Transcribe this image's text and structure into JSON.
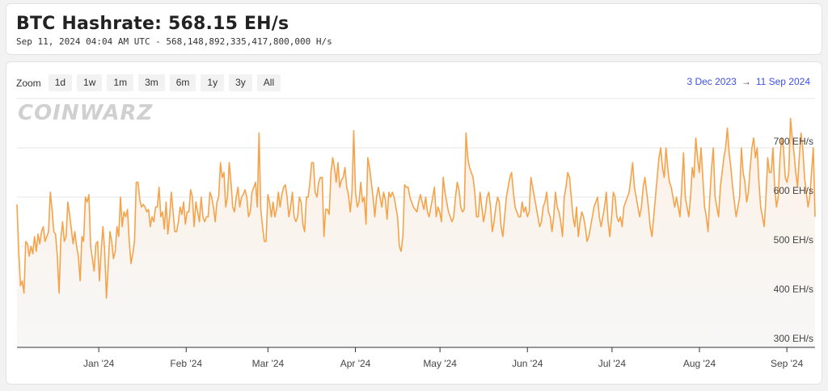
{
  "header": {
    "title": "BTC Hashrate: 568.15 EH/s",
    "subtitle": "Sep 11, 2024 04:04 AM UTC - 568,148,892,335,417,800,000 H/s"
  },
  "zoom": {
    "label": "Zoom",
    "buttons": [
      "1d",
      "1w",
      "1m",
      "3m",
      "6m",
      "1y",
      "3y",
      "All"
    ]
  },
  "range": {
    "from": "3 Dec 2023",
    "arrow": "→",
    "to": "11 Sep 2024"
  },
  "watermark": "COINWARZ",
  "colors": {
    "line": "#f5a34a",
    "area_top": "#fdf1e6",
    "link": "#3b50e6"
  },
  "chart_data": {
    "type": "area",
    "title": "BTC Hashrate: 568.15 EH/s",
    "xlabel": "",
    "ylabel": "",
    "ylim": [
      295,
      800
    ],
    "yticks": [
      300,
      400,
      500,
      600,
      700
    ],
    "ytick_labels": [
      "300 EH/s",
      "400 EH/s",
      "500 EH/s",
      "600 EH/s",
      "700 EH/s"
    ],
    "x_start": "2023-12-03",
    "x_end": "2024-09-11",
    "xticks": [
      "2024-01-01",
      "2024-02-01",
      "2024-03-01",
      "2024-04-01",
      "2024-05-01",
      "2024-06-01",
      "2024-07-01",
      "2024-08-01",
      "2024-09-01"
    ],
    "xtick_labels": [
      "Jan '24",
      "Feb '24",
      "Mar '24",
      "Apr '24",
      "May '24",
      "Jun '24",
      "Jul '24",
      "Aug '24",
      "Sep '24"
    ],
    "grid": true,
    "series": [
      {
        "values": [
          585,
          490,
          420,
          430,
          405,
          510,
          505,
          480,
          500,
          485,
          520,
          490,
          525,
          505,
          530,
          540,
          510,
          520,
          530,
          610,
          575,
          530,
          525,
          480,
          405,
          515,
          550,
          510,
          520,
          590,
          565,
          535,
          505,
          530,
          500,
          480,
          430,
          520,
          510,
          600,
          590,
          605,
          500,
          475,
          450,
          505,
          510,
          430,
          490,
          540,
          490,
          395,
          460,
          530,
          510,
          475,
          490,
          540,
          520,
          600,
          540,
          570,
          560,
          575,
          510,
          465,
          485,
          510,
          630,
          630,
          595,
          580,
          585,
          580,
          570,
          575,
          540,
          560,
          550,
          580,
          580,
          620,
          560,
          570,
          535,
          590,
          525,
          560,
          610,
          570,
          530,
          530,
          550,
          580,
          565,
          590,
          545,
          570,
          570,
          615,
          600,
          540,
          590,
          570,
          550,
          600,
          560,
          550,
          560,
          560,
          610,
          600,
          580,
          550,
          590,
          600,
          670,
          640,
          650,
          580,
          600,
          670,
          630,
          580,
          570,
          600,
          620,
          580,
          600,
          605,
          615,
          600,
          560,
          570,
          610,
          620,
          630,
          580,
          730,
          575,
          540,
          510,
          510,
          605,
          590,
          560,
          590,
          560,
          575,
          610,
          580,
          605,
          620,
          625,
          600,
          560,
          580,
          610,
          560,
          550,
          560,
          600,
          590,
          545,
          530,
          600,
          600,
          630,
          670,
          670,
          610,
          600,
          630,
          640,
          640,
          520,
          575,
          575,
          565,
          650,
          680,
          660,
          630,
          670,
          620,
          635,
          640,
          660,
          620,
          605,
          570,
          610,
          735,
          610,
          580,
          590,
          630,
          590,
          600,
          545,
          680,
          660,
          630,
          600,
          560,
          600,
          620,
          600,
          580,
          610,
          595,
          555,
          610,
          600,
          610,
          600,
          580,
          560,
          500,
          490,
          520,
          625,
          620,
          620,
          600,
          590,
          580,
          575,
          570,
          590,
          605,
          590,
          575,
          600,
          570,
          560,
          580,
          600,
          620,
          560,
          580,
          570,
          550,
          640,
          610,
          590,
          570,
          560,
          550,
          560,
          600,
          630,
          615,
          580,
          570,
          575,
          730,
          680,
          660,
          650,
          640,
          610,
          560,
          560,
          610,
          580,
          550,
          570,
          600,
          610,
          580,
          530,
          550,
          580,
          600,
          590,
          540,
          520,
          560,
          600,
          620,
          640,
          650,
          610,
          580,
          570,
          560,
          560,
          590,
          570,
          580,
          560,
          570,
          640,
          620,
          600,
          580,
          560,
          540,
          550,
          580,
          590,
          610,
          570,
          560,
          530,
          560,
          610,
          580,
          570,
          550,
          520,
          600,
          620,
          650,
          640,
          600,
          560,
          540,
          580,
          520,
          550,
          570,
          560,
          540,
          510,
          520,
          540,
          560,
          580,
          590,
          600,
          560,
          540,
          560,
          580,
          610,
          550,
          520,
          560,
          610,
          600,
          560,
          550,
          560,
          540,
          580,
          590,
          600,
          610,
          640,
          670,
          620,
          600,
          580,
          560,
          580,
          620,
          640,
          610,
          580,
          540,
          520,
          560,
          600,
          640,
          680,
          700,
          660,
          640,
          700,
          660,
          630,
          620,
          600,
          580,
          600,
          580,
          560,
          620,
          690,
          600,
          580,
          560,
          600,
          660,
          640,
          720,
          680,
          650,
          700,
          640,
          580,
          560,
          530,
          600,
          660,
          700,
          600,
          580,
          560,
          620,
          650,
          680,
          700,
          740,
          690,
          660,
          620,
          590,
          560,
          580,
          600,
          700,
          650,
          630,
          590,
          610,
          660,
          700,
          720,
          680,
          700,
          630,
          580,
          560,
          540,
          600,
          680,
          650,
          650,
          700,
          620,
          580,
          600,
          680,
          720,
          700,
          640,
          630,
          650,
          760,
          720,
          690,
          650,
          620,
          680,
          730,
          700,
          640,
          610,
          580,
          600,
          650,
          700,
          560
        ]
      }
    ]
  }
}
